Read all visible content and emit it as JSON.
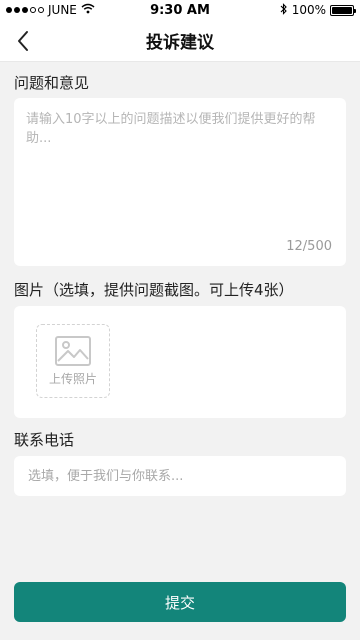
{
  "status_bar": {
    "carrier": "JUNE",
    "time": "9:30 AM",
    "battery": "100%",
    "icons": [
      "signal-icon",
      "wifi-icon",
      "bluetooth-icon",
      "battery-icon"
    ]
  },
  "nav": {
    "title": "投诉建议",
    "back_icon": "chevron-left-icon"
  },
  "problem": {
    "label": "问题和意见",
    "placeholder": "请输入10字以上的问题描述以便我们提供更好的帮助...",
    "value": "",
    "counter": "12/500"
  },
  "images": {
    "label": "图片（选填，提供问题截图。可上传4张）",
    "upload_label": "上传照片",
    "upload_icon": "image-icon"
  },
  "contact": {
    "label": "联系电话",
    "placeholder": "选填，便于我们与你联系...",
    "value": ""
  },
  "submit": {
    "label": "提交"
  },
  "colors": {
    "accent": "#13857a",
    "background": "#f2f2f2",
    "card": "#ffffff",
    "placeholder": "#b5b5b5"
  }
}
